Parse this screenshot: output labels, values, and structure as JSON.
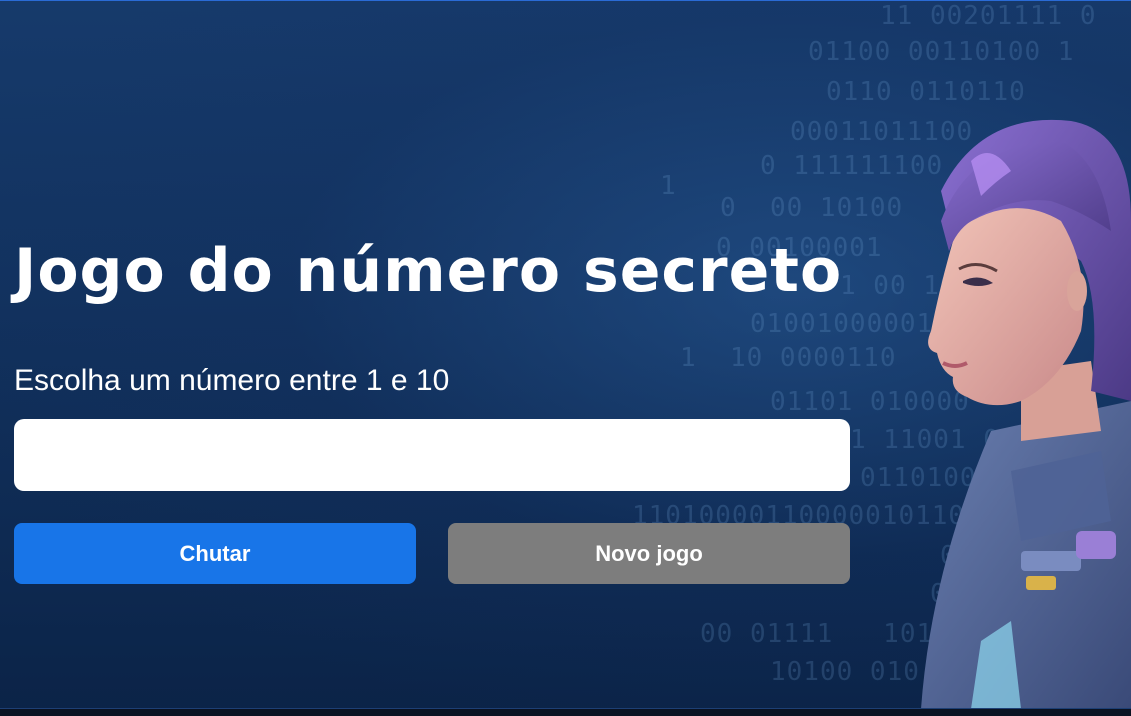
{
  "game": {
    "title": "Jogo do número secreto",
    "instruction": "Escolha um número entre 1 e 10",
    "input_value": "",
    "input_placeholder": "",
    "guess_button_label": "Chutar",
    "new_game_button_label": "Novo jogo"
  },
  "colors": {
    "primary_button": "#1875e8",
    "secondary_button": "#7d7d7d",
    "background": "#12325f"
  },
  "icons": {
    "avatar": "woman-astronaut-illustration"
  }
}
